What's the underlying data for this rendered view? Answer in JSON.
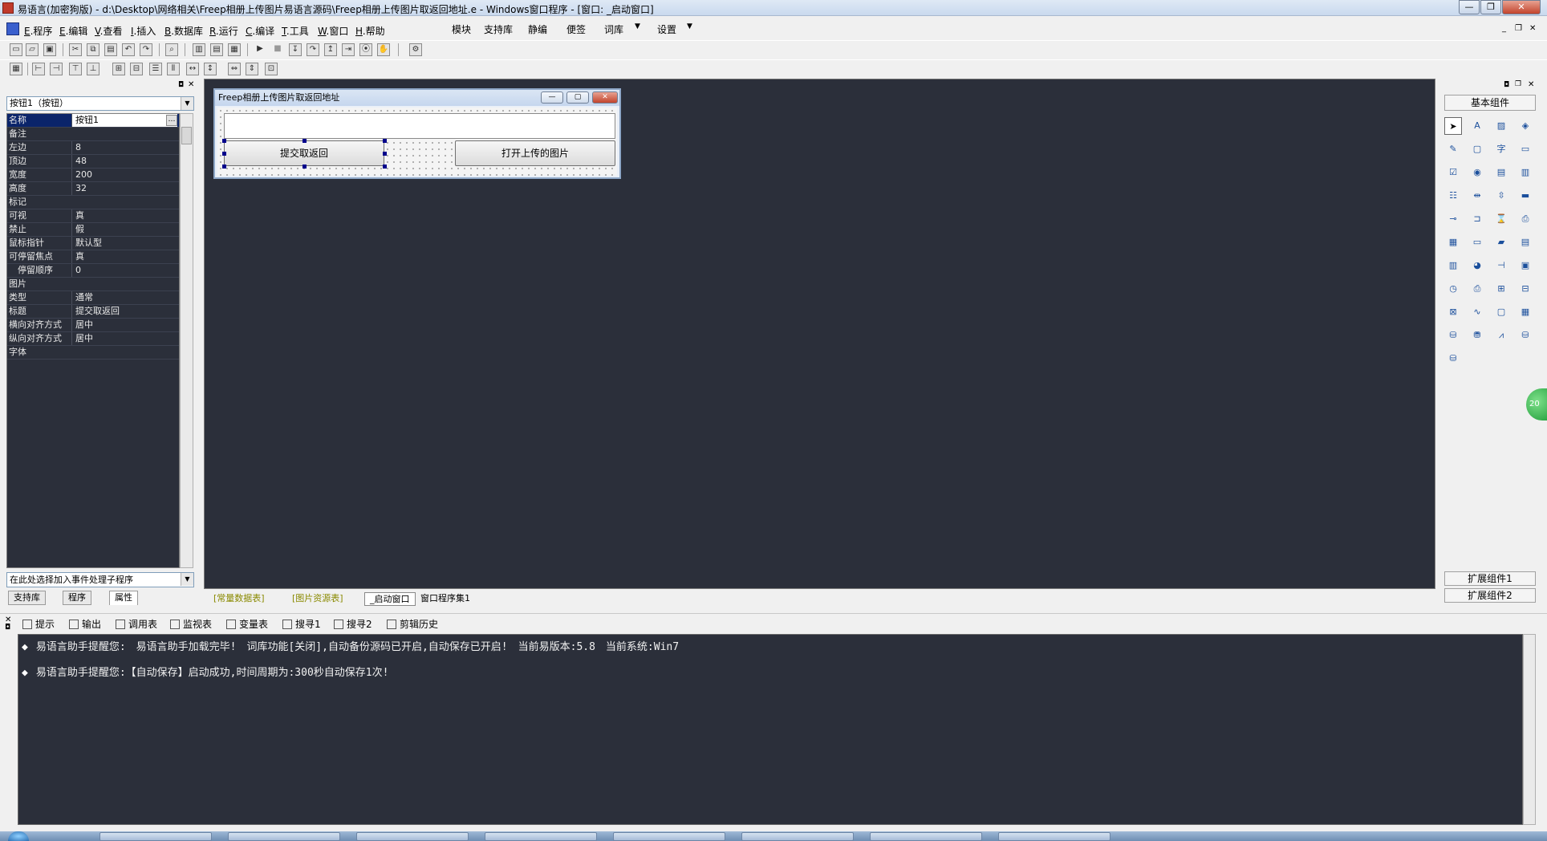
{
  "window": {
    "title": "易语言(加密狗版) - d:\\Desktop\\网络相关\\Freep相册上传图片易语言源码\\Freep相册上传图片取返回地址.e - Windows窗口程序 - [窗口: _启动窗口]",
    "min_label": "—",
    "restore_label": "❐",
    "close_label": "✕"
  },
  "menu": {
    "items": [
      {
        "key": "E",
        "label": ".程序"
      },
      {
        "key": "E",
        "label": ".编辑"
      },
      {
        "key": "V",
        "label": ".查看"
      },
      {
        "key": "I",
        "label": ".插入"
      },
      {
        "key": "B",
        "label": ".数据库"
      },
      {
        "key": "R",
        "label": ".运行"
      },
      {
        "key": "C",
        "label": ".编译"
      },
      {
        "key": "T",
        "label": ".工具"
      },
      {
        "key": "W",
        "label": ".窗口"
      },
      {
        "key": "H",
        "label": ".帮助"
      }
    ],
    "extra": [
      "模块",
      "支持库",
      "静编",
      "便签",
      "词库",
      "设置"
    ]
  },
  "properties": {
    "object_select": "按钮1（按钮）",
    "rows": [
      {
        "name": "名称",
        "value": "按钮1"
      },
      {
        "name": "备注",
        "value": ""
      },
      {
        "name": "左边",
        "value": "8"
      },
      {
        "name": "顶边",
        "value": "48"
      },
      {
        "name": "宽度",
        "value": "200"
      },
      {
        "name": "高度",
        "value": "32"
      },
      {
        "name": "标记",
        "value": ""
      },
      {
        "name": "可视",
        "value": "真"
      },
      {
        "name": "禁止",
        "value": "假"
      },
      {
        "name": "鼠标指针",
        "value": "默认型"
      },
      {
        "name": "可停留焦点",
        "value": "真"
      },
      {
        "name": "　停留顺序",
        "value": "0"
      },
      {
        "name": "图片",
        "value": ""
      },
      {
        "name": "类型",
        "value": "通常"
      },
      {
        "name": "标题",
        "value": "提交取返回"
      },
      {
        "name": "横向对齐方式",
        "value": "居中"
      },
      {
        "name": "纵向对齐方式",
        "value": "居中"
      },
      {
        "name": "字体",
        "value": ""
      }
    ],
    "event_select": "在此处选择加入事件处理子程序",
    "tabs": [
      "支持库",
      "程序",
      "属性"
    ]
  },
  "form": {
    "title": "Freep相册上传图片取返回地址",
    "button1": "提交取返回",
    "button2": "打开上传的图片"
  },
  "design_tabs": [
    "[常量数据表]",
    "[图片资源表]",
    "_启动窗口",
    "窗口程序集1"
  ],
  "toolbox": {
    "header": "基本组件",
    "ext1": "扩展组件1",
    "ext2": "扩展组件2",
    "badge": "20"
  },
  "output": {
    "tabs": [
      "提示",
      "输出",
      "调用表",
      "监视表",
      "变量表",
      "搜寻1",
      "搜寻2",
      "剪辑历史"
    ],
    "lines": [
      "易语言助手提醒您:　易语言助手加载完毕!　词库功能[关闭],自动备份源码已开启,自动保存已开启!　当前易版本:5.8　当前系统:Win7",
      "易语言助手提醒您:【自动保存】启动成功,时间周期为:300秒自动保存1次!"
    ]
  }
}
